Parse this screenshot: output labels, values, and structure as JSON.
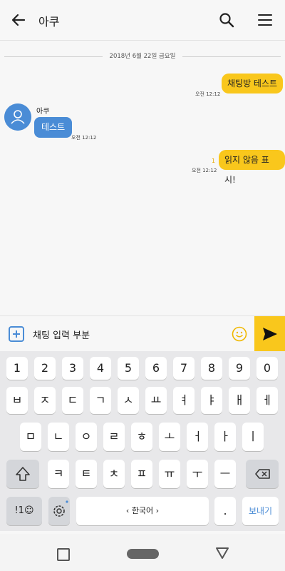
{
  "header": {
    "title": "아쿠"
  },
  "chat": {
    "date": "2018년 6월 22일 금요일",
    "messages": [
      {
        "side": "out",
        "text": "채팅방 테스트",
        "time": "오전 12:12",
        "unread": ""
      },
      {
        "side": "in",
        "sender": "아쿠",
        "text": "테스트",
        "time": "오전 12:12"
      },
      {
        "side": "out",
        "text": "읽지 않음 표시!",
        "time": "오전 12:12",
        "unread": "1"
      }
    ]
  },
  "input": {
    "text": "채팅 입력 부분"
  },
  "keyboard": {
    "numbers": [
      "1",
      "2",
      "3",
      "4",
      "5",
      "6",
      "7",
      "8",
      "9",
      "0"
    ],
    "row1": [
      "ㅂ",
      "ㅈ",
      "ㄷ",
      "ㄱ",
      "ㅅ",
      "ㅛ",
      "ㅕ",
      "ㅑ",
      "ㅐ",
      "ㅔ"
    ],
    "row2": [
      "ㅁ",
      "ㄴ",
      "ㅇ",
      "ㄹ",
      "ㅎ",
      "ㅗ",
      "ㅓ",
      "ㅏ",
      "ㅣ"
    ],
    "row3": [
      "ㅋ",
      "ㅌ",
      "ㅊ",
      "ㅍ",
      "ㅠ",
      "ㅜ",
      "ㅡ"
    ],
    "symbols_label": "!1☺",
    "space_label": "‹ 한국어 ›",
    "period_label": ".",
    "send_label": "보내기"
  },
  "colors": {
    "accent": "#f9c71c",
    "blue": "#4a8cd6"
  }
}
